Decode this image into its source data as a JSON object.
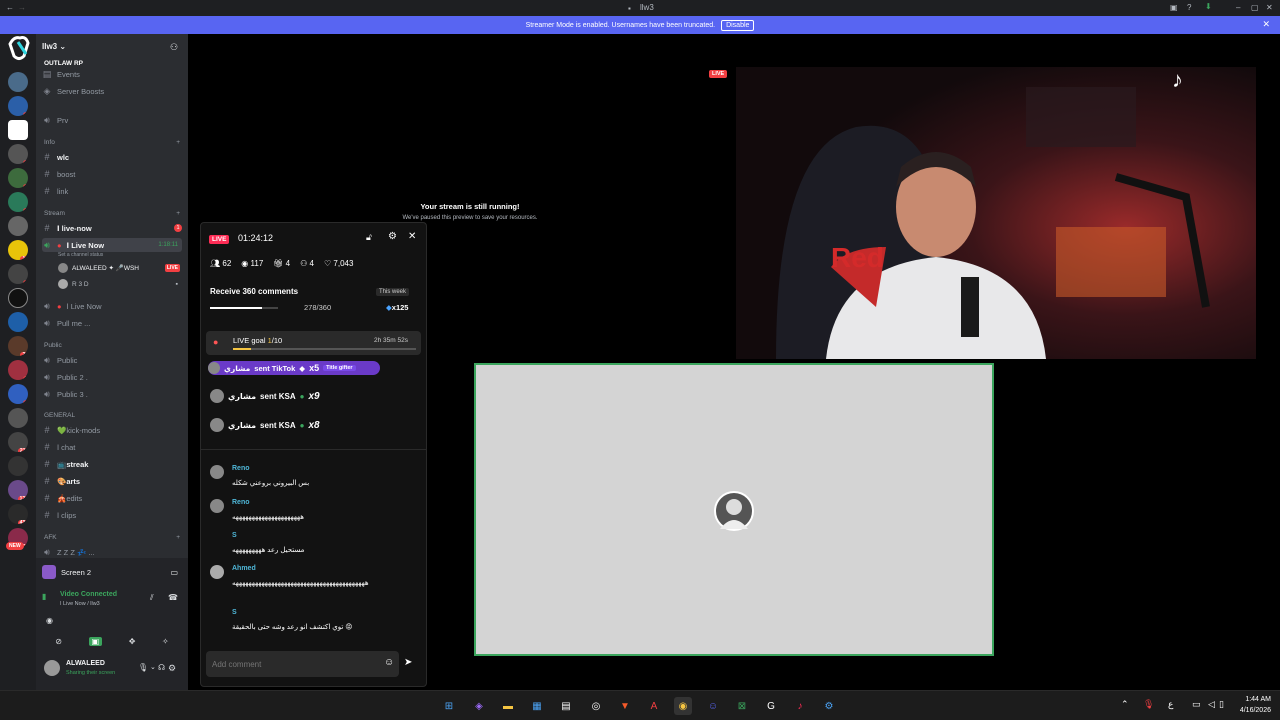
{
  "titlebar": {
    "title": "llw3"
  },
  "banner": {
    "text": "Streamer Mode is enabled. Usernames have been truncated.",
    "button": "Disable"
  },
  "server": {
    "name": "llw3",
    "logo_text": "OUTLAW RP"
  },
  "guild_badges": [
    "1",
    "3",
    "3",
    "3",
    "14",
    "4",
    "28",
    "5",
    "1",
    "211",
    "128",
    "436",
    "64",
    "NEW"
  ],
  "channels": {
    "events": "Events",
    "boosts": "Server Boosts",
    "prv": "Prv",
    "cat_info": "Info",
    "wlc": "wlc",
    "boost": "boost",
    "link": "link",
    "cat_stream": "Stream",
    "live_now_text": "ا live-now",
    "live_now_text_badge": "1",
    "live_now_voice": "ا Live Now",
    "live_now_time": "1:18:11",
    "live_now_status": "Set a channel status",
    "user1": "ALWALEED ✦ 🎤WSH",
    "user1_badge": "LIVE",
    "user2": "R 3 D",
    "live_now2": "ا Live Now",
    "pull_me": "Pull me ...",
    "cat_public": "Public",
    "public1": "Public",
    "public2": "Public 2 .",
    "public3": "Public 3 .",
    "cat_general": "GENERAL",
    "kick_mods": "💚kick-mods",
    "chat": "ا chat",
    "streak": "📺streak",
    "arts": "🎨arts",
    "edits": "🎪edits",
    "clips": "ا clips",
    "cat_afk": "AFK",
    "zzz": "Z Z Z 💤 ..."
  },
  "screen_panel": {
    "title": "Screen 2"
  },
  "voice": {
    "status": "Video Connected",
    "channel": "ا Live Now / llw3"
  },
  "user": {
    "name": "ALWALEED",
    "status": "Sharing their screen"
  },
  "stream": {
    "paused_title": "Your stream is still running!",
    "paused_sub": "We've paused this preview to save your resources.",
    "live_badge": "LIVE"
  },
  "tiktok": {
    "live": "LIVE",
    "timer": "01:24:12",
    "stats": {
      "viewers": "62",
      "views": "117",
      "gifts": "4",
      "joins": "4",
      "likes": "7,043"
    },
    "goal": {
      "title": "Receive 360 comments",
      "period": "This week",
      "progress": "278/360",
      "fraction": 0.772,
      "reward": "x125"
    },
    "live_goal": {
      "label": "LIVE goal",
      "count": "1",
      "total": "/10",
      "time": "2h 35m 52s"
    },
    "gifts": [
      {
        "user": "مشاري",
        "text": "sent TikTok",
        "mult": "x5",
        "tag": "Title gifter"
      },
      {
        "user": "مشاري",
        "text": "sent KSA",
        "mult": "x9"
      },
      {
        "user": "مشاري",
        "text": "sent KSA",
        "mult": "x8"
      }
    ],
    "comments": [
      {
        "user": "Reno",
        "text": "بس البيروني بروعني شكله"
      },
      {
        "user": "Reno",
        "text": "هههههههههههههههههههههه"
      },
      {
        "user": "S",
        "text": "مستحيل رعد هههههههههه"
      },
      {
        "user": "Ahmed",
        "text": "هههههههههههههههههههههههههههههههههههههههههه"
      },
      {
        "user": "S",
        "text": "توي اكتشف انو رعد وشه حتى بالحقيقة 😡"
      }
    ],
    "input_placeholder": "Add comment"
  },
  "clock": {
    "time": "1:44 AM",
    "date": "4/16/2026"
  },
  "colors": {
    "accent": "#5865f2",
    "live": "#f23f42",
    "tiktok": "#fe2c55",
    "connected": "#3ba55d"
  }
}
